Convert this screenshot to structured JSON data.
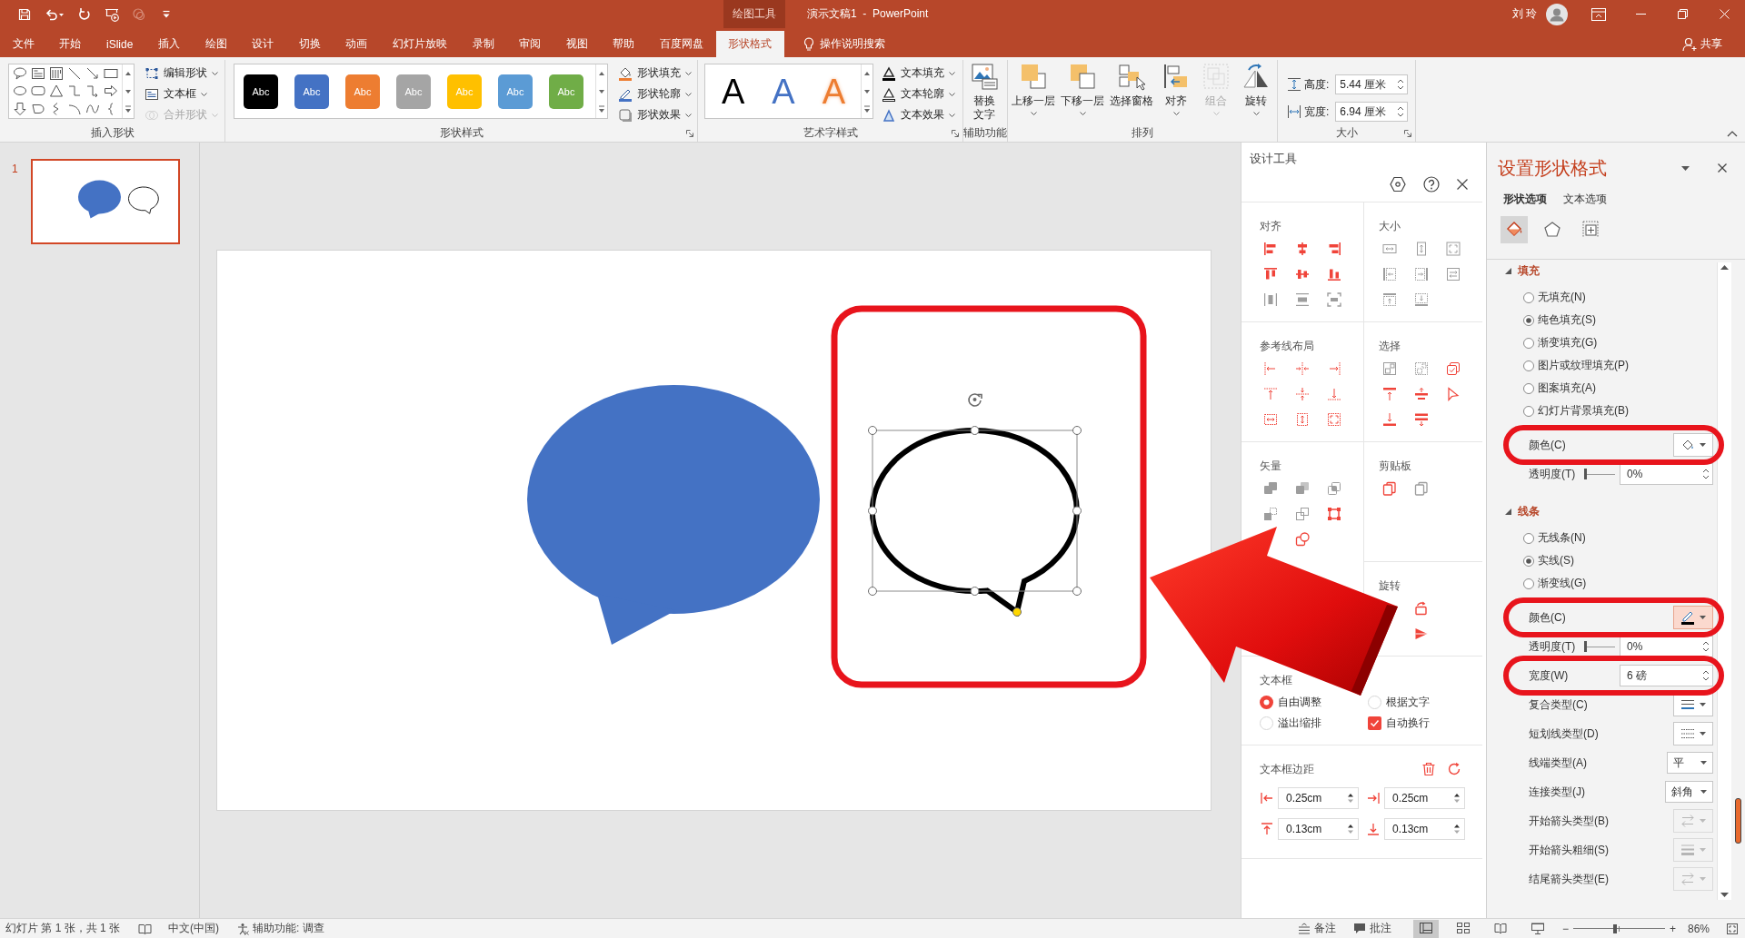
{
  "title_bar": {
    "quick_access": [
      {
        "kind": "save",
        "disabled": false
      },
      {
        "kind": "undo",
        "disabled": false
      },
      {
        "kind": "repeat",
        "disabled": false
      },
      {
        "kind": "present",
        "disabled": false
      },
      {
        "kind": "touch",
        "disabled": true
      },
      {
        "kind": "customize",
        "disabled": false
      }
    ],
    "context_label": "绘图工具",
    "title": "演示文稿1  -  PowerPoint",
    "user": "刘 玲"
  },
  "ribbon": {
    "tabs": [
      {
        "label": "文件",
        "selected": false
      },
      {
        "label": "开始",
        "selected": false
      },
      {
        "label": "iSlide",
        "selected": false
      },
      {
        "label": "插入",
        "selected": false
      },
      {
        "label": "绘图",
        "selected": false
      },
      {
        "label": "设计",
        "selected": false
      },
      {
        "label": "切换",
        "selected": false
      },
      {
        "label": "动画",
        "selected": false
      },
      {
        "label": "幻灯片放映",
        "selected": false
      },
      {
        "label": "录制",
        "selected": false
      },
      {
        "label": "审阅",
        "selected": false
      },
      {
        "label": "视图",
        "selected": false
      },
      {
        "label": "帮助",
        "selected": false
      },
      {
        "label": "百度网盘",
        "selected": false
      },
      {
        "label": "形状格式",
        "selected": true
      }
    ],
    "tell_me": "操作说明搜索",
    "share": "共享",
    "groups": [
      {
        "kind": "shapes",
        "label": "插入形状",
        "launcher": false,
        "commands": [
          {
            "kind": "edit",
            "label": "编辑形状",
            "dropdown": true,
            "disabled": false
          },
          {
            "kind": "textbox",
            "label": "文本框",
            "dropdown": true,
            "disabled": false
          },
          {
            "kind": "merge",
            "label": "合并形状",
            "dropdown": true,
            "disabled": true
          }
        ]
      },
      {
        "kind": "styles",
        "label": "形状样式",
        "launcher": true,
        "swatches": [
          {
            "label": "Abc",
            "color": "#000000"
          },
          {
            "label": "Abc",
            "color": "#4472c4"
          },
          {
            "label": "Abc",
            "color": "#ed7d31"
          },
          {
            "label": "Abc",
            "color": "#a5a5a5"
          },
          {
            "label": "Abc",
            "color": "#ffc000"
          },
          {
            "label": "Abc",
            "color": "#5b9bd5"
          },
          {
            "label": "Abc",
            "color": "#70ad47"
          }
        ],
        "commands": [
          {
            "kind": "fill",
            "label": "形状填充",
            "dropdown": true,
            "disabled": false
          },
          {
            "kind": "outline",
            "label": "形状轮廓",
            "dropdown": true,
            "disabled": false
          },
          {
            "kind": "effects",
            "label": "形状效果",
            "dropdown": true,
            "disabled": false
          }
        ]
      },
      {
        "kind": "wordart",
        "label": "艺术字样式",
        "launcher": true,
        "samples": [
          {
            "kind": "solid",
            "label": "A",
            "color": "#000000"
          },
          {
            "kind": "solid",
            "label": "A",
            "color": "#4472c4"
          },
          {
            "kind": "outline",
            "label": "A",
            "color": "#ed7d31"
          }
        ],
        "commands": [
          {
            "kind": "textfill",
            "label": "文本填充",
            "dropdown": true,
            "disabled": false
          },
          {
            "kind": "textoutline",
            "label": "文本轮廓",
            "dropdown": true,
            "disabled": false
          },
          {
            "kind": "texteffects",
            "label": "文本效果",
            "dropdown": true,
            "disabled": false
          }
        ]
      },
      {
        "kind": "large",
        "label": "辅助功能",
        "launcher": false,
        "buttons": [
          {
            "kind": "alttext",
            "label": "替换文字",
            "dropdown": false,
            "disabled": false
          }
        ]
      },
      {
        "kind": "large",
        "label": "排列",
        "launcher": false,
        "buttons": [
          {
            "kind": "forward",
            "label": "上移一层",
            "dropdown": true,
            "disabled": false
          },
          {
            "kind": "backward",
            "label": "下移一层",
            "dropdown": true,
            "disabled": false
          },
          {
            "kind": "pane",
            "label": "选择窗格",
            "dropdown": false,
            "disabled": false
          },
          {
            "kind": "align",
            "label": "对齐",
            "dropdown": true,
            "disabled": false
          },
          {
            "kind": "group",
            "label": "组合",
            "dropdown": true,
            "disabled": true
          },
          {
            "kind": "rotate",
            "label": "旋转",
            "dropdown": true,
            "disabled": false
          }
        ]
      },
      {
        "kind": "size",
        "label": "大小",
        "launcher": true,
        "fields": [
          {
            "kind": "height",
            "label": "高度:",
            "value": "5.44 厘米"
          },
          {
            "kind": "width",
            "label": "宽度:",
            "value": "6.94 厘米"
          }
        ]
      }
    ]
  },
  "slides_panel": {
    "slides": [
      {
        "number": "1",
        "selected": true
      }
    ]
  },
  "slide": {
    "shapes": [
      {
        "kind": "filled",
        "color": "#4472c4",
        "selected": false,
        "circled": false
      },
      {
        "kind": "outline",
        "color": "#000000",
        "selected": true,
        "circled": true
      }
    ]
  },
  "design_tools": {
    "title": "设计工具",
    "sections": [
      {
        "kind": "align",
        "label": "对齐",
        "icons": [
          {
            "kind": "align-left",
            "disabled": false
          },
          {
            "kind": "align-center",
            "disabled": false
          },
          {
            "kind": "align-right",
            "disabled": false
          },
          {
            "kind": "align-top",
            "disabled": false
          },
          {
            "kind": "align-middle",
            "disabled": false
          },
          {
            "kind": "align-bottom",
            "disabled": false
          },
          {
            "kind": "distribute-horizontal",
            "disabled": true
          },
          {
            "kind": "distribute-vertical",
            "disabled": true
          },
          {
            "kind": "fit-frame",
            "disabled": true
          }
        ]
      },
      {
        "kind": "size",
        "label": "大小",
        "icons": [
          {
            "kind": "same-width",
            "disabled": true
          },
          {
            "kind": "same-height",
            "disabled": true
          },
          {
            "kind": "same-size",
            "disabled": true
          },
          {
            "kind": "extend-left",
            "disabled": true
          },
          {
            "kind": "extend-right",
            "disabled": true
          },
          {
            "kind": "swap-size",
            "disabled": true
          },
          {
            "kind": "extend-top",
            "disabled": true
          },
          {
            "kind": "extend-bottom",
            "disabled": true
          }
        ]
      },
      {
        "kind": "guides",
        "label": "参考线布局",
        "icons": [
          {
            "kind": "guide-left",
            "disabled": false
          },
          {
            "kind": "guide-center",
            "disabled": false
          },
          {
            "kind": "guide-right",
            "disabled": false
          },
          {
            "kind": "guide-top",
            "disabled": false
          },
          {
            "kind": "guide-middle",
            "disabled": false
          },
          {
            "kind": "guide-bottom",
            "disabled": false
          },
          {
            "kind": "guide-width",
            "disabled": false
          },
          {
            "kind": "guide-height",
            "disabled": false
          },
          {
            "kind": "guide-size",
            "disabled": false
          }
        ]
      },
      {
        "kind": "select",
        "label": "选择",
        "icons": [
          {
            "kind": "select-similar",
            "disabled": true
          },
          {
            "kind": "select-outline",
            "disabled": true
          },
          {
            "kind": "select-stack",
            "disabled": false
          },
          {
            "kind": "select-top",
            "disabled": false
          },
          {
            "kind": "select-middle",
            "disabled": false
          },
          {
            "kind": "select-pointer",
            "disabled": false
          },
          {
            "kind": "select-bottom",
            "disabled": false
          },
          {
            "kind": "select-spread",
            "disabled": false
          }
        ]
      },
      {
        "kind": "vector",
        "label": "矢量",
        "icons": [
          {
            "kind": "union",
            "disabled": true
          },
          {
            "kind": "subtract",
            "disabled": true
          },
          {
            "kind": "intersect",
            "disabled": true
          },
          {
            "kind": "fragment",
            "disabled": true
          },
          {
            "kind": "combine",
            "disabled": true
          },
          {
            "kind": "edit-points",
            "disabled": false
          },
          {
            "kind": "join",
            "disabled": false
          }
        ]
      },
      {
        "kind": "clipboard",
        "label": "剪贴板",
        "icons": [
          {
            "kind": "copy",
            "disabled": false
          },
          {
            "kind": "paste",
            "disabled": true
          }
        ]
      },
      {
        "kind": "rotate",
        "label": "旋转",
        "icons": [
          {
            "kind": "rotate-right",
            "disabled": false
          },
          {
            "kind": "flip-horizontal",
            "disabled": false
          }
        ]
      },
      {
        "kind": "options",
        "label": "文本框",
        "options": [
          {
            "kind": "radio",
            "label": "自由调整",
            "selected": true
          },
          {
            "kind": "radio",
            "label": "根据文字",
            "selected": false
          },
          {
            "kind": "radio",
            "label": "溢出缩排",
            "selected": false
          },
          {
            "kind": "checkbox",
            "label": "自动换行",
            "checked": true
          }
        ]
      },
      {
        "kind": "margins",
        "label": "文本框边距",
        "fields": [
          {
            "kind": "left",
            "value": "0.25cm"
          },
          {
            "kind": "right",
            "value": "0.25cm"
          },
          {
            "kind": "top",
            "value": "0.13cm"
          },
          {
            "kind": "bottom",
            "value": "0.13cm"
          }
        ]
      }
    ]
  },
  "format_pane": {
    "title": "设置形状格式",
    "tabs": [
      {
        "label": "形状选项",
        "selected": true
      },
      {
        "label": "文本选项",
        "selected": false
      }
    ],
    "icon_tabs": [
      {
        "kind": "fill",
        "selected": true
      },
      {
        "kind": "effects",
        "selected": false
      },
      {
        "kind": "layout",
        "selected": false
      }
    ],
    "sections": [
      {
        "label": "填充",
        "expanded": true,
        "rows": [
          {
            "kind": "radio",
            "label": "无填充(N)",
            "selected": false
          },
          {
            "kind": "radio",
            "label": "纯色填充(S)",
            "selected": true
          },
          {
            "kind": "radio",
            "label": "渐变填充(G)",
            "selected": false
          },
          {
            "kind": "radio",
            "label": "图片或纹理填充(P)",
            "selected": false
          },
          {
            "kind": "radio",
            "label": "图案填充(A)",
            "selected": false
          },
          {
            "kind": "radio",
            "label": "幻灯片背景填充(B)",
            "selected": false
          },
          {
            "kind": "fillcolor",
            "label": "颜色(C)",
            "circled": true
          },
          {
            "kind": "slider",
            "label": "透明度(T)",
            "level": 0,
            "value": "0%",
            "circled": false
          }
        ]
      },
      {
        "label": "线条",
        "expanded": true,
        "rows": [
          {
            "kind": "radio",
            "label": "无线条(N)",
            "selected": false
          },
          {
            "kind": "radio",
            "label": "实线(S)",
            "selected": true
          },
          {
            "kind": "radio",
            "label": "渐变线(G)",
            "selected": false
          },
          {
            "kind": "linecolor",
            "label": "颜色(C)",
            "circled": true
          },
          {
            "kind": "slider",
            "label": "透明度(T)",
            "level": 0,
            "value": "0%",
            "circled": false
          },
          {
            "kind": "spinner",
            "label": "宽度(W)",
            "value": "6 磅",
            "circled": true
          },
          {
            "kind": "compound",
            "label": "复合类型(C)",
            "disabled": false,
            "circled": false
          },
          {
            "kind": "dash",
            "label": "短划线类型(D)",
            "disabled": false,
            "circled": false
          },
          {
            "kind": "dropdown",
            "label": "线端类型(A)",
            "value": "平",
            "circled": false
          },
          {
            "kind": "dropdown",
            "label": "连接类型(J)",
            "value": "斜角",
            "circled": false
          },
          {
            "kind": "arrowtype",
            "label": "开始箭头类型(B)",
            "disabled": true,
            "circled": false
          },
          {
            "kind": "arrowsize",
            "label": "开始箭头粗细(S)",
            "disabled": true,
            "circled": false
          },
          {
            "kind": "arrowtype",
            "label": "结尾箭头类型(E)",
            "disabled": true,
            "circled": false
          }
        ]
      }
    ]
  },
  "status_bar": {
    "slide_info": "幻灯片 第 1 张，共 1 张",
    "language": "中文(中国)",
    "accessibility": "辅助功能: 调查",
    "notes": "备注",
    "comments": "批注",
    "views": [
      {
        "kind": "normal",
        "selected": true
      },
      {
        "kind": "sorter",
        "selected": false
      },
      {
        "kind": "reading",
        "selected": false
      },
      {
        "kind": "slideshow",
        "selected": false
      }
    ],
    "zoom_out": "−",
    "zoom_in": "+",
    "zoom": {
      "level": 0.45,
      "reading": "86%"
    }
  }
}
